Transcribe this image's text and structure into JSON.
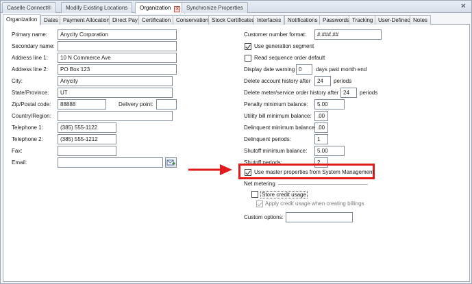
{
  "doc_tabs": [
    {
      "label": "Caselle Connect®"
    },
    {
      "label": "Modify Existing Locations"
    },
    {
      "label": "Organization"
    },
    {
      "label": "Synchronize Properties"
    }
  ],
  "window_close_glyph": "✕",
  "sub_tabs": [
    "Organization",
    "Dates",
    "Payment Allocation",
    "Direct Pay",
    "Certification",
    "Conservation",
    "Stock Certificates",
    "Interfaces",
    "Notifications",
    "Passwords",
    "Tracking",
    "User-Defined",
    "Notes"
  ],
  "left": {
    "primary_name": {
      "label": "Primary name:",
      "value": "Anycity Corporation"
    },
    "secondary_name": {
      "label": "Secondary name:",
      "value": ""
    },
    "address1": {
      "label": "Address line 1:",
      "value": "10 N Commerce Ave"
    },
    "address2": {
      "label": "Address line 2:",
      "value": "PO Box 123"
    },
    "city": {
      "label": "City:",
      "value": "Anycity"
    },
    "state": {
      "label": "State/Province:",
      "value": "UT"
    },
    "zip": {
      "label": "Zip/Postal code:",
      "value": "88888"
    },
    "delivery_point": {
      "label": "Delivery point:",
      "value": ""
    },
    "country": {
      "label": "Country/Region:",
      "value": ""
    },
    "telephone1": {
      "label": "Telephone 1:",
      "value": "(385) 555-1122"
    },
    "telephone2": {
      "label": "Telephone 2:",
      "value": "(385) 555-1212"
    },
    "fax": {
      "label": "Fax:",
      "value": ""
    },
    "email": {
      "label": "Email:",
      "value": ""
    },
    "email_button_icon": "email-icon"
  },
  "right": {
    "customer_number_format": {
      "label": "Customer number format:",
      "value": "#.###.##"
    },
    "use_generation_segment": {
      "label": "Use generation segment",
      "checked": true
    },
    "read_sequence_order_default": {
      "label": "Read sequence order default",
      "checked": false
    },
    "display_date_warning": {
      "label": "Display date warning",
      "value": "0",
      "suffix": "days past month end"
    },
    "delete_account_history": {
      "label": "Delete account history after",
      "value": "24",
      "suffix": "periods"
    },
    "delete_meter_history": {
      "label": "Delete meter/service order history after",
      "value": "24",
      "suffix": "periods"
    },
    "penalty_min_balance": {
      "label": "Penalty minimum balance:",
      "value": "5.00"
    },
    "utility_bill_min_balance": {
      "label": "Utility bill minimum balance:",
      "value": ".00"
    },
    "delinquent_min_balance": {
      "label": "Delinquent minimum balance:",
      "value": ".00"
    },
    "delinquent_periods": {
      "label": "Delinquent periods:",
      "value": "1"
    },
    "shutoff_min_balance": {
      "label": "Shutoff minimum balance:",
      "value": "5.00"
    },
    "shutoff_periods": {
      "label": "Shutoff periods:",
      "value": "2"
    },
    "use_master_properties": {
      "label": "Use master properties from System Management",
      "checked": true
    },
    "net_metering": {
      "label": "Net metering"
    },
    "store_credit_usage": {
      "label": "Store credit usage",
      "checked": false
    },
    "apply_credit_usage": {
      "label": "Apply credit usage when creating billings",
      "checked": true,
      "disabled": true
    },
    "custom_options": {
      "label": "Custom options:",
      "value": ""
    }
  },
  "colors": {
    "highlight": "#e11b1b",
    "arrow": "#e11b1b"
  }
}
